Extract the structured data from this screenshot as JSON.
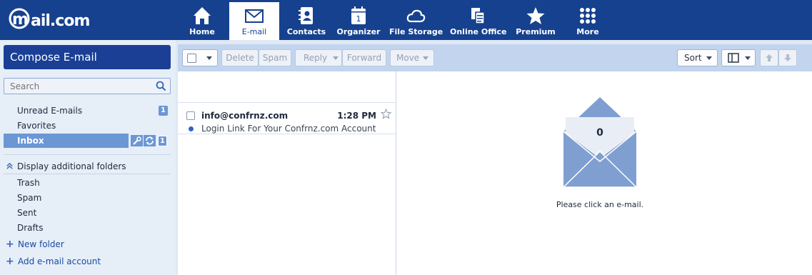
{
  "app": {
    "logo_text": "mail.com"
  },
  "nav": {
    "items": [
      {
        "label": "Home",
        "icon": "home-icon"
      },
      {
        "label": "E-mail",
        "icon": "envelope-icon"
      },
      {
        "label": "Contacts",
        "icon": "contacts-icon"
      },
      {
        "label": "Organizer",
        "icon": "calendar-icon"
      },
      {
        "label": "File Storage",
        "icon": "cloud-icon"
      },
      {
        "label": "Online Office",
        "icon": "documents-icon"
      },
      {
        "label": "Premium",
        "icon": "star-icon"
      },
      {
        "label": "More",
        "icon": "grid-icon"
      }
    ],
    "active": "E-mail",
    "calendar_day": "1"
  },
  "sidebar": {
    "compose_label": "Compose E-mail",
    "search_placeholder": "Search",
    "quick_folders": [
      {
        "label": "Unread E-mails",
        "count": "1"
      },
      {
        "label": "Favorites"
      },
      {
        "label": "Inbox",
        "count": "1",
        "selected": true
      }
    ],
    "additional_toggle": "Display additional folders",
    "folders": [
      "Trash",
      "Spam",
      "Sent",
      "Drafts"
    ],
    "new_folder": "New folder",
    "add_account": "Add e-mail account"
  },
  "toolbar": {
    "delete": "Delete",
    "spam": "Spam",
    "reply": "Reply",
    "forward": "Forward",
    "move": "Move",
    "sort": "Sort"
  },
  "messages": [
    {
      "from": "info@confrnz.com",
      "time": "1:28 PM",
      "subject": "Login Link For Your Confrnz.com Account",
      "unread": true
    }
  ],
  "preview": {
    "count": "0",
    "message": "Please click an e-mail."
  },
  "colors": {
    "topbar": "#16418e",
    "compose": "#1a3f95",
    "selected_folder": "#6b97d4",
    "toolbar": "#c2d4ee",
    "envelope": "#7f9fd1"
  }
}
